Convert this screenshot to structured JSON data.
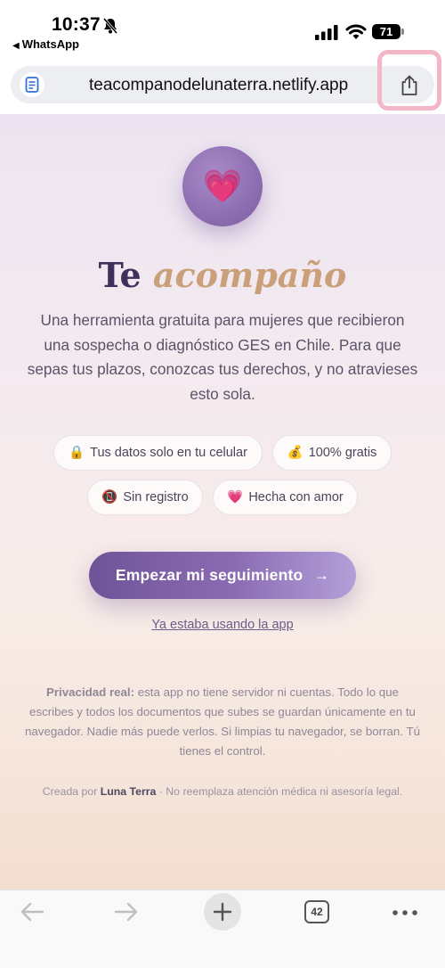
{
  "status_bar": {
    "time": "10:37",
    "back_app": "WhatsApp",
    "battery": "71"
  },
  "browser": {
    "url": "teacompanodelunaterra.netlify.app",
    "tabs_count": "42"
  },
  "hero": {
    "emoji": "💗",
    "title_part1": "Te",
    "title_part2": "acompaño",
    "description": "Una herramienta gratuita para mujeres que recibieron una sospecha o diagnóstico GES en Chile. Para que sepas tus plazos, conozcas tus derechos, y no atravieses esto sola."
  },
  "pills": [
    {
      "emoji": "🔒",
      "label": "Tus datos solo en tu celular"
    },
    {
      "emoji": "💰",
      "label": "100% gratis"
    },
    {
      "emoji": "📵",
      "label": "Sin registro"
    },
    {
      "emoji": "💗",
      "label": "Hecha con amor"
    }
  ],
  "cta": {
    "label": "Empezar mi seguimiento",
    "arrow": "→"
  },
  "existing_link": "Ya estaba usando la app",
  "privacy": {
    "bold": "Privacidad real:",
    "text": " esta app no tiene servidor ni cuentas. Todo lo que escribes y todos los documentos que subes se guardan únicamente en tu navegador. Nadie más puede verlos. Si limpias tu navegador, se borran. Tú tienes el control."
  },
  "footer": {
    "prefix": "Creada por ",
    "author": "Luna Terra",
    "suffix": " · No reemplaza atención médica ni asesoría legal."
  },
  "colors": {
    "brand_purple": "#6f5397",
    "accent_gold": "#c9a07a",
    "title_dark": "#3e2f5b"
  }
}
